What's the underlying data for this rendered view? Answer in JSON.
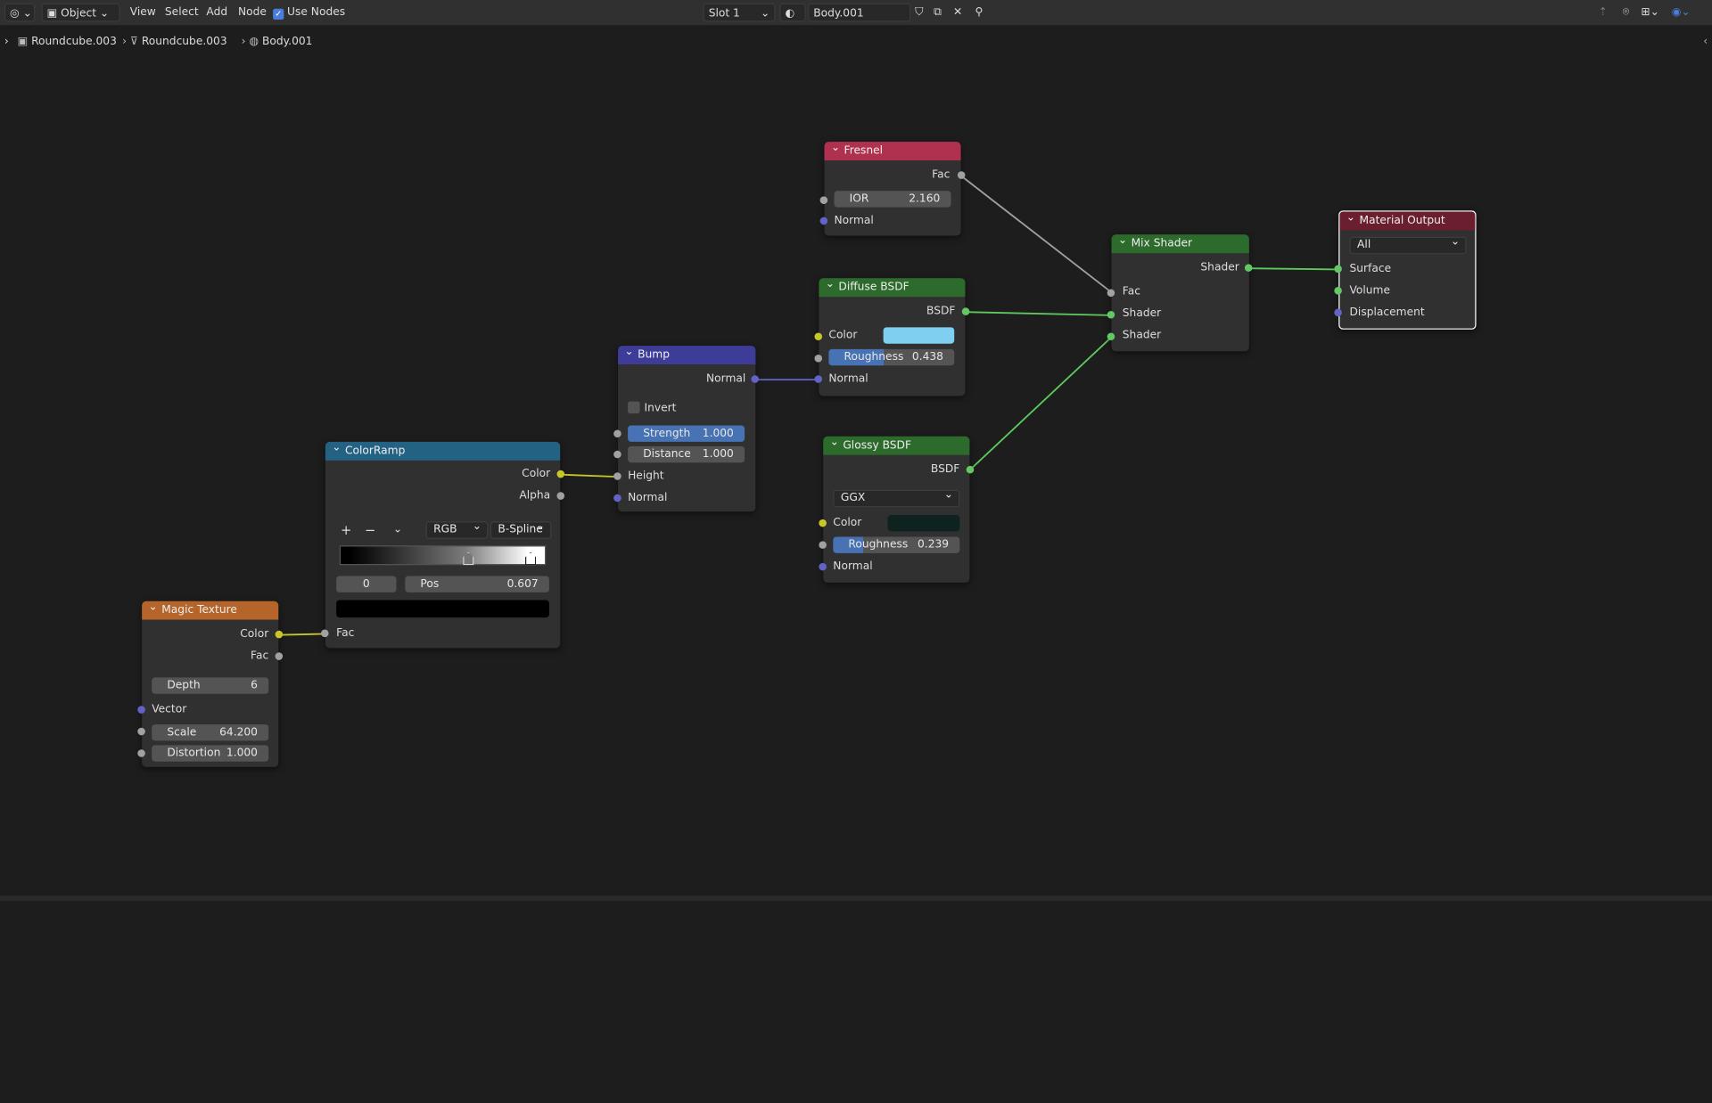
{
  "header": {
    "editor_icon": "node-editor-icon",
    "mode": "Object",
    "menus": [
      "View",
      "Select",
      "Add",
      "Node"
    ],
    "use_nodes": "Use Nodes",
    "slot": "Slot 1",
    "material": "Body.001"
  },
  "breadcrumb": [
    "Roundcube.003",
    "Roundcube.003",
    "Body.001"
  ],
  "nodes": {
    "fresnel": {
      "title": "Fresnel",
      "out_fac": "Fac",
      "ior_label": "IOR",
      "ior": "2.160",
      "normal": "Normal",
      "color": "#b0304f"
    },
    "diffuse": {
      "title": "Diffuse BSDF",
      "out": "BSDF",
      "color_label": "Color",
      "color_value": "#7fd0f0",
      "rough_label": "Roughness",
      "rough": "0.438",
      "normal": "Normal",
      "header_color": "#2c6b2c"
    },
    "glossy": {
      "title": "Glossy BSDF",
      "out": "BSDF",
      "dist": "GGX",
      "color_label": "Color",
      "color_value": "#0e2220",
      "rough_label": "Roughness",
      "rough": "0.239",
      "normal": "Normal"
    },
    "mix": {
      "title": "Mix Shader",
      "out": "Shader",
      "fac": "Fac",
      "s1": "Shader",
      "s2": "Shader"
    },
    "output": {
      "title": "Material Output",
      "target": "All",
      "surface": "Surface",
      "volume": "Volume",
      "displacement": "Displacement",
      "color": "#6b1f2e"
    },
    "bump": {
      "title": "Bump",
      "out": "Normal",
      "invert": "Invert",
      "strength_label": "Strength",
      "strength": "1.000",
      "distance_label": "Distance",
      "distance": "1.000",
      "height": "Height",
      "normal": "Normal",
      "color": "#3d3d99"
    },
    "ramp": {
      "title": "ColorRamp",
      "color": "Color",
      "alpha": "Alpha",
      "mode": "RGB",
      "interp": "B-Spline",
      "index": "0",
      "pos_label": "Pos",
      "pos": "0.607",
      "fac": "Fac",
      "plus": "+",
      "minus": "−",
      "header_color": "#246283"
    },
    "magic": {
      "title": "Magic Texture",
      "color": "Color",
      "fac": "Fac",
      "depth_label": "Depth",
      "depth": "6",
      "vector": "Vector",
      "scale_label": "Scale",
      "scale": "64.200",
      "dist_label": "Distortion",
      "dist": "1.000",
      "header_color": "#b5652a"
    }
  }
}
